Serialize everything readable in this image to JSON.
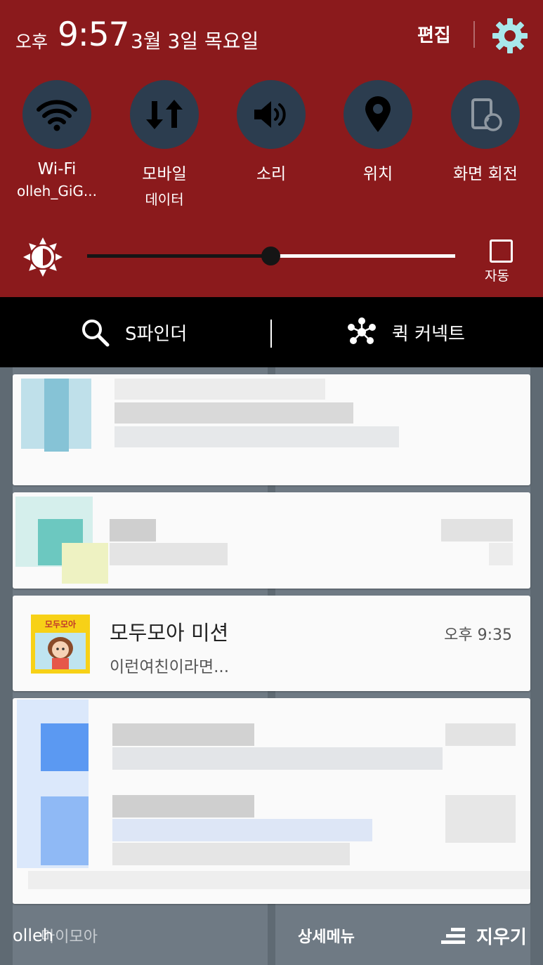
{
  "status": {
    "ampm": "오후",
    "time": "9:57",
    "date": "3월 3일 목요일",
    "edit_label": "편집"
  },
  "toggles": [
    {
      "line1": "Wi-Fi",
      "line2": "olleh_GiG...",
      "icon": "wifi-icon"
    },
    {
      "line1": "모바일",
      "line2": "데이터",
      "icon": "mobile-data-icon"
    },
    {
      "line1": "소리",
      "line2": "",
      "icon": "sound-icon"
    },
    {
      "line1": "위치",
      "line2": "",
      "icon": "location-icon"
    },
    {
      "line1": "화면 회전",
      "line2": "",
      "icon": "screen-rotation-icon"
    }
  ],
  "brightness": {
    "level": 0.5,
    "auto_label": "자동"
  },
  "bar": {
    "sfinder_label": "S파인더",
    "quick_connect_label": "퀵 커넥트"
  },
  "notification": {
    "title": "모두모아 미션",
    "text": "이런여친이라면...",
    "time": "오후 9:35",
    "icon_text": "모두모아"
  },
  "background": {
    "left_label": "마이모아",
    "right_label": "상세메뉴"
  },
  "bottom": {
    "carrier": "olleh",
    "clear_label": "지우기"
  },
  "colors": {
    "panel": "#8b1a1c",
    "toggle_circle": "#2c3d4f",
    "gear": "#a8e8ec",
    "bar": "#000000",
    "card": "#fafafa"
  }
}
